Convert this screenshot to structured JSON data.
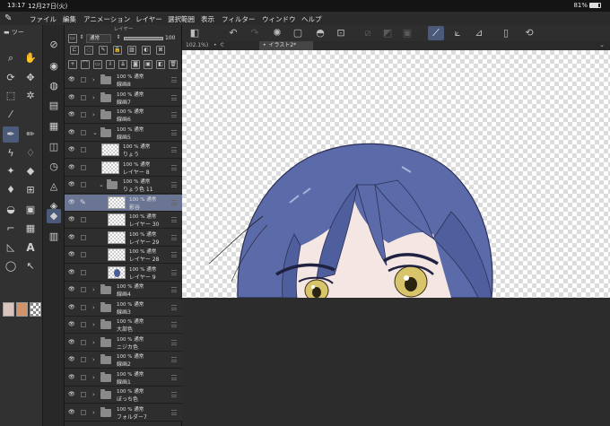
{
  "status_bar": {
    "time": "13:17",
    "date": "12月27日(火)",
    "battery": "81%"
  },
  "menu": [
    {
      "label": "ファイル"
    },
    {
      "label": "編集"
    },
    {
      "label": "アニメーション"
    },
    {
      "label": "レイヤー"
    },
    {
      "label": "選択範囲"
    },
    {
      "label": "表示"
    },
    {
      "label": "フィルター"
    },
    {
      "label": "ウィンドウ"
    },
    {
      "label": "ヘルプ"
    }
  ],
  "layer_panel": {
    "title": "レイヤー",
    "blend_mode": "通常",
    "opacity": "100",
    "layers": [
      {
        "opacity": "100 % 通常",
        "name": "線画8",
        "type": "folder",
        "indent": 0
      },
      {
        "opacity": "100 % 通常",
        "name": "線画7",
        "type": "folder",
        "indent": 0
      },
      {
        "opacity": "100 % 通常",
        "name": "線画6",
        "type": "folder",
        "indent": 0
      },
      {
        "opacity": "100 % 通常",
        "name": "線画5",
        "type": "folder-open",
        "indent": 0
      },
      {
        "opacity": "100 % 通常",
        "name": "りょう",
        "type": "layer",
        "indent": 1
      },
      {
        "opacity": "100 % 通常",
        "name": "レイヤー 8",
        "type": "layer",
        "indent": 1
      },
      {
        "opacity": "100 % 通常",
        "name": "りょう色 11",
        "type": "folder-open",
        "indent": 1
      },
      {
        "opacity": "100 % 通常",
        "name": "影谷",
        "type": "layer",
        "indent": 2,
        "selected": true
      },
      {
        "opacity": "100 % 通常",
        "name": "レイヤー 30",
        "type": "layer",
        "indent": 2
      },
      {
        "opacity": "100 % 通常",
        "name": "レイヤー 29",
        "type": "layer",
        "indent": 2
      },
      {
        "opacity": "100 % 通常",
        "name": "レイヤー 28",
        "type": "layer",
        "indent": 2
      },
      {
        "opacity": "100 % 通常",
        "name": "レイヤー 9",
        "type": "layer",
        "indent": 2,
        "thumb": "blue"
      },
      {
        "opacity": "100 % 通常",
        "name": "線画4",
        "type": "folder",
        "indent": 0
      },
      {
        "opacity": "100 % 通常",
        "name": "線画3",
        "type": "folder",
        "indent": 0
      },
      {
        "opacity": "100 % 通常",
        "name": "大部色",
        "type": "folder",
        "indent": 0
      },
      {
        "opacity": "100 % 通常",
        "name": "ニジカ色",
        "type": "folder",
        "indent": 0
      },
      {
        "opacity": "100 % 通常",
        "name": "線画2",
        "type": "folder",
        "indent": 0
      },
      {
        "opacity": "100 % 通常",
        "name": "線画1",
        "type": "folder",
        "indent": 0
      },
      {
        "opacity": "100 % 通常",
        "name": "ぼっち色",
        "type": "folder",
        "indent": 0
      },
      {
        "opacity": "100 % 通常",
        "name": "フォルダー7",
        "type": "folder",
        "indent": 0
      }
    ]
  },
  "tabs": [
    {
      "label": "102.1%)"
    },
    {
      "label": "ぐ"
    },
    {
      "label": "イラスト2*",
      "active": true
    }
  ],
  "toolbox": {
    "tool_label": "ツー"
  },
  "colors": {
    "main": "#d9c4bd",
    "sub": "#d2936b",
    "panel": "#2e2e2e",
    "selected": "#6a7593",
    "accent": "#4a5a78",
    "hair": "#5b6aa8"
  }
}
